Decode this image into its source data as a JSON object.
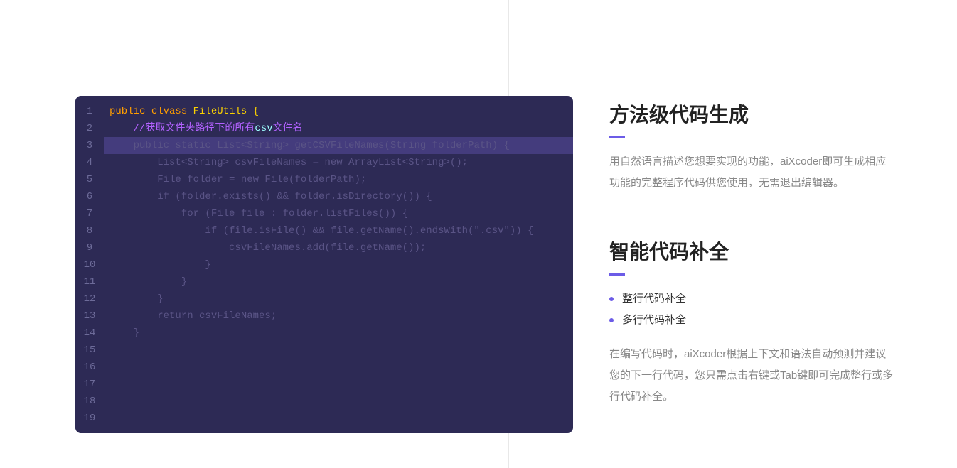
{
  "editor": {
    "line_numbers": [
      "1",
      "2",
      "3",
      "4",
      "5",
      "6",
      "7",
      "8",
      "9",
      "10",
      "11",
      "12",
      "13",
      "14",
      "15",
      "16",
      "17",
      "18",
      "19"
    ],
    "line1": {
      "kw1": "public",
      "kw2": "clvass",
      "cls": "FileUtils",
      "brace": " {"
    },
    "line2": {
      "indent": "    ",
      "slashes": "//",
      "text1": "获取文件夹路径下的所有",
      "hl": "csv",
      "text2": "文件名"
    },
    "line3": "    public static List<String> getCSVFileNames(String folderPath) {",
    "line4": "        List<String> csvFileNames = new ArrayList<String>();",
    "line5": "        File folder = new File(folderPath);",
    "line6": "        if (folder.exists() && folder.isDirectory()) {",
    "line7": "            for (File file : folder.listFiles()) {",
    "line8": "                if (file.isFile() && file.getName().endsWith(\".csv\")) {",
    "line9": "                    csvFileNames.add(file.getName());",
    "line10": "                }",
    "line11": "            }",
    "line12": "        }",
    "line13": "        return csvFileNames;",
    "line14": "    }"
  },
  "features": {
    "section1": {
      "title": "方法级代码生成",
      "desc": "用自然语言描述您想要实现的功能，aiXcoder即可生成相应功能的完整程序代码供您使用，无需退出编辑器。"
    },
    "section2": {
      "title": "智能代码补全",
      "bullets": [
        "整行代码补全",
        "多行代码补全"
      ],
      "desc": "在编写代码时，aiXcoder根据上下文和语法自动预测并建议您的下一行代码，您只需点击右键或Tab键即可完成整行或多行代码补全。"
    }
  }
}
